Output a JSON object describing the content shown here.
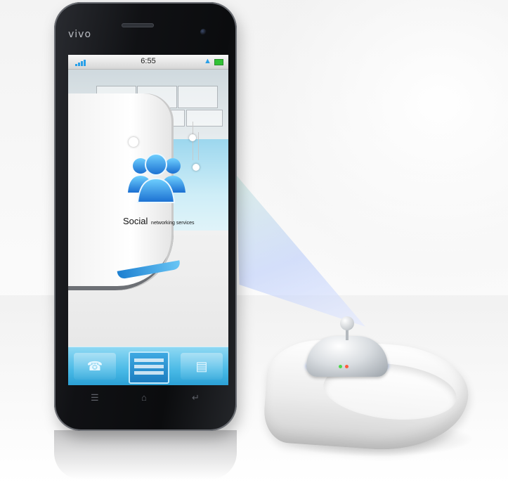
{
  "device": {
    "brand": "vivo",
    "status_bar": {
      "time": "6:55",
      "signal_icon": "signal-bars-icon",
      "wifi_icon": "wifi-icon",
      "battery_icon": "battery-icon"
    },
    "app_tile": {
      "label": "Social",
      "sublabel": "networking services",
      "icon": "people-group-icon"
    },
    "dock": {
      "left_icon": "phone-icon",
      "center_icon": "app-grid-icon",
      "right_icon": "chat-icon"
    },
    "softkeys": {
      "menu_icon": "menu-icon",
      "home_icon": "home-icon",
      "back_icon": "back-icon"
    }
  },
  "colors": {
    "accent_blue": "#2aa0e8",
    "dock_blue": "#48b9e6",
    "battery_green": "#32c236",
    "projector_ring": "#2c5bd9"
  }
}
